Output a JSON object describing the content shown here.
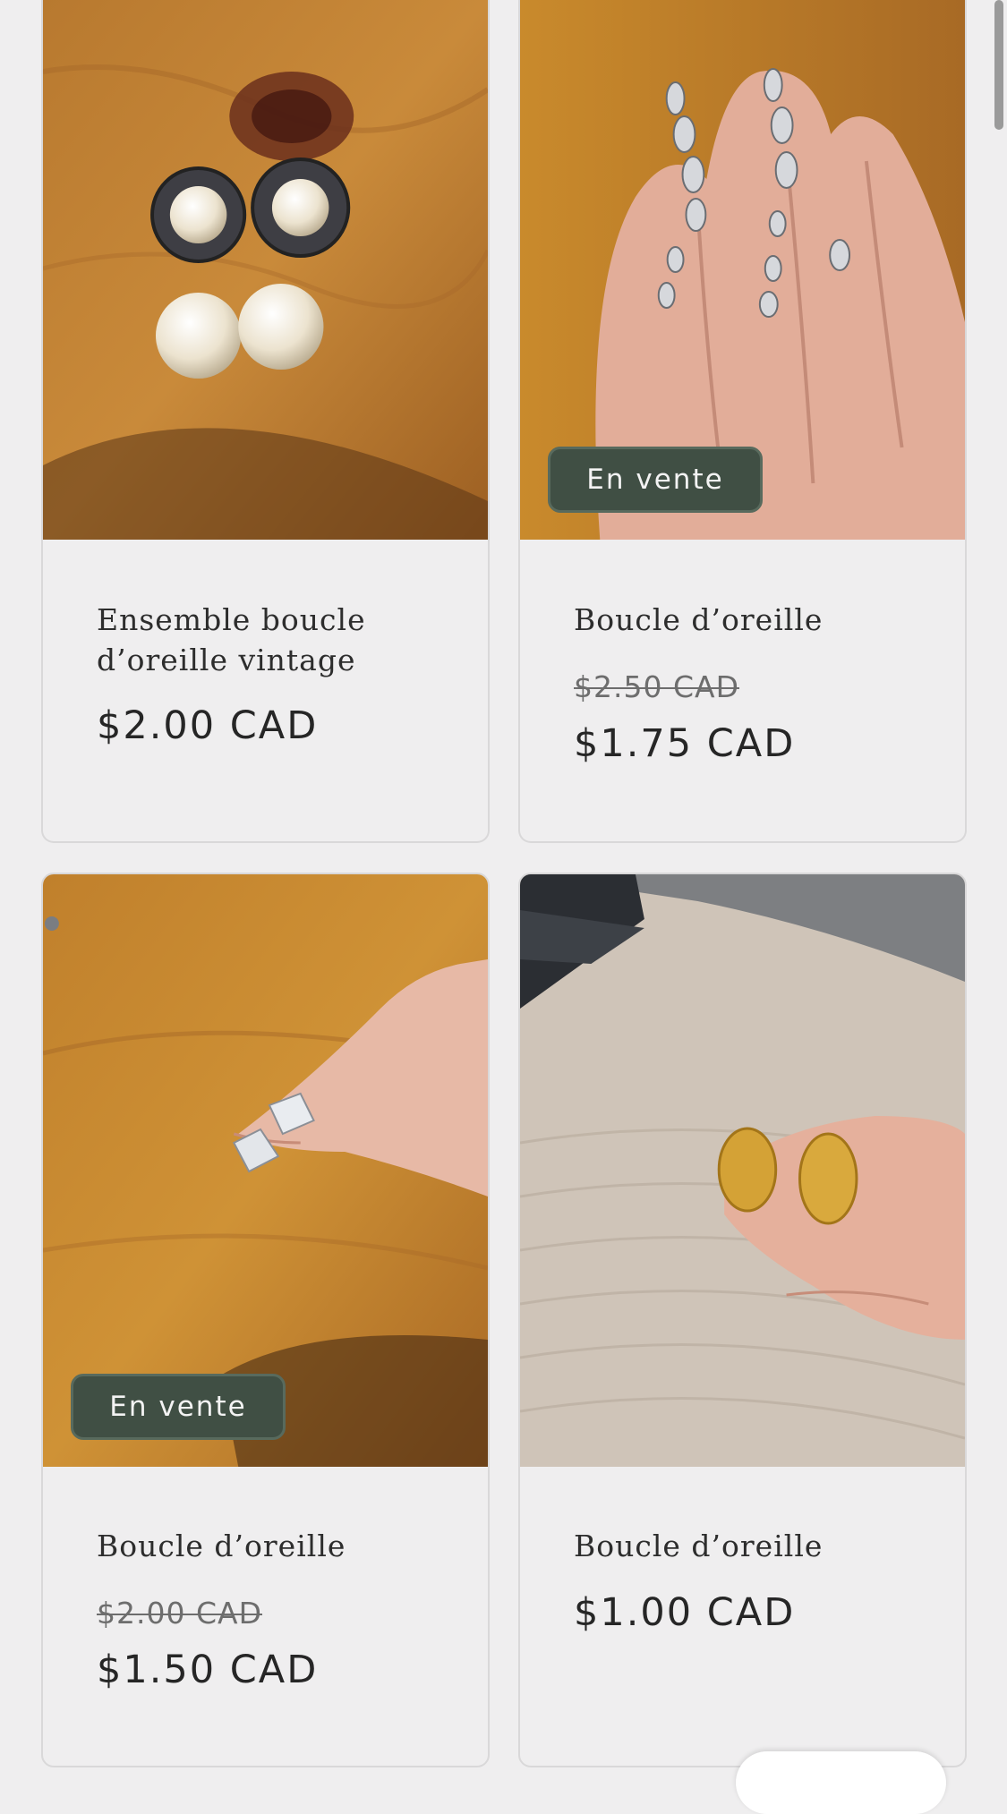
{
  "products": [
    {
      "title": "Ensemble boucle d’oreille vintage",
      "price": "$2.00 CAD",
      "image_icon": "pearl-earrings-photo"
    },
    {
      "title": "Boucle d’oreille",
      "compare_price": "$2.50 CAD",
      "price": "$1.75 CAD",
      "badge": "En vente",
      "image_icon": "crystal-drop-earrings-photo"
    },
    {
      "title": "Boucle d’oreille",
      "compare_price": "$2.00 CAD",
      "price": "$1.50 CAD",
      "badge": "En vente",
      "image_icon": "square-crystal-studs-photo"
    },
    {
      "title": "Boucle d’oreille",
      "price": "$1.00 CAD",
      "image_icon": "gold-oval-earrings-photo"
    }
  ],
  "colors": {
    "page_background": "#efeeef",
    "badge_background": "#404f44",
    "text": "#2b2b2b",
    "strikethrough_price": "#6d6d6d"
  }
}
